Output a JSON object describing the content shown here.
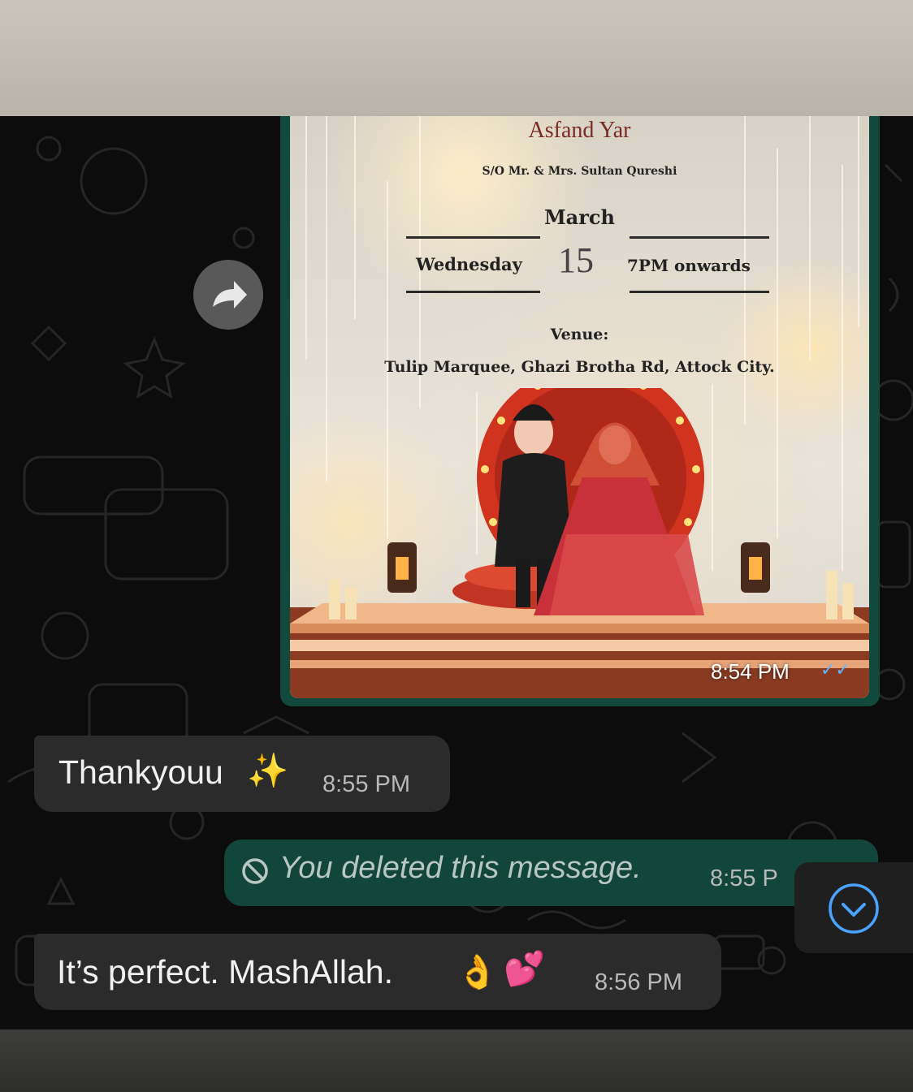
{
  "invitation": {
    "groom_name": "Asfand Yar",
    "parents": "S/O Mr. & Mrs. Sultan Qureshi",
    "month": "March",
    "weekday": "Wednesday",
    "day": "15",
    "time": "7PM onwards",
    "venue_label": "Venue:",
    "venue": "Tulip Marquee, Ghazi Brotha Rd, Attock City."
  },
  "messages": [
    {
      "direction": "outgoing",
      "type": "image",
      "time": "8:54 PM",
      "status": "read"
    },
    {
      "direction": "incoming",
      "type": "text",
      "text": "Thankyouu",
      "emoji": "sparkles",
      "time": "8:55 PM"
    },
    {
      "direction": "outgoing",
      "type": "deleted",
      "text": "You deleted this message.",
      "time": "8:55 P"
    },
    {
      "direction": "incoming",
      "type": "text",
      "text": "It’s perfect. MashAllah.",
      "emoji": "ok-hand, two-hearts",
      "time": "8:56 PM"
    }
  ],
  "icons": {
    "forward": "forward-arrow-icon",
    "scroll_down": "chevron-down-circle-icon",
    "deleted": "prohibited-icon",
    "read_receipt": "double-check-icon"
  },
  "colors": {
    "chat_background": "#0c0c0c",
    "incoming_bubble": "#2b2b2b",
    "outgoing_bubble": "#12463a",
    "read_ticks": "#5fb8ff",
    "scroll_icon": "#4aa3ff"
  }
}
